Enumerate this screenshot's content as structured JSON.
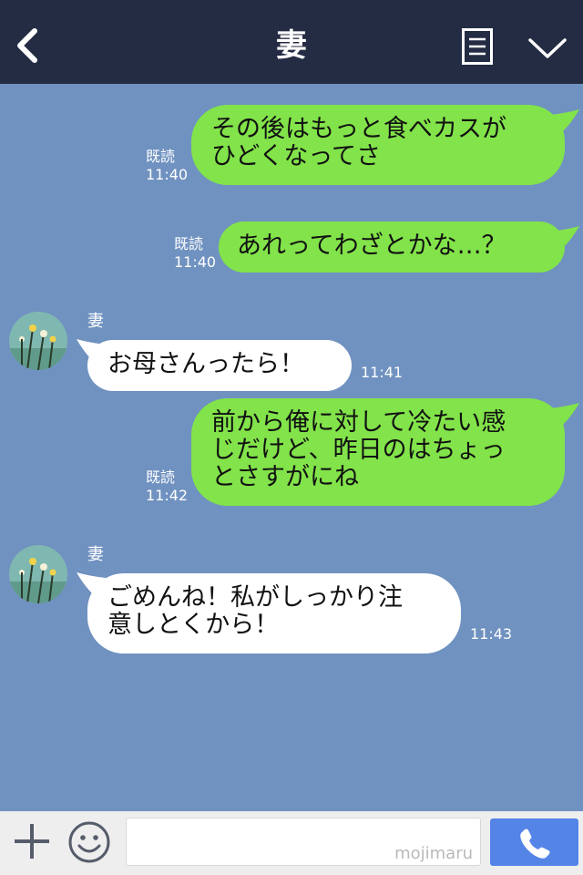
{
  "header": {
    "title": "妻",
    "colors": {
      "bar": "#242c44",
      "chat_bg": "#7092c0",
      "outgoing": "#82e34a",
      "incoming": "#ffffff",
      "call": "#5384e6"
    }
  },
  "messages": [
    {
      "direction": "outgoing",
      "lines": [
        "その後はもっと食べカスが",
        "ひどくなってさ"
      ],
      "read": "既読",
      "time": "11:40"
    },
    {
      "direction": "outgoing",
      "lines": [
        "あれってわざとかな…？"
      ],
      "read": "既読",
      "time": "11:40"
    },
    {
      "direction": "incoming",
      "sender": "妻",
      "lines": [
        "お母さんったら！"
      ],
      "time": "11:41"
    },
    {
      "direction": "outgoing",
      "lines": [
        "前から俺に対して冷たい感",
        "じだけど、昨日のはちょっ",
        "とさすがにね"
      ],
      "read": "既読",
      "time": "11:42"
    },
    {
      "direction": "incoming",
      "sender": "妻",
      "lines": [
        "ごめんね！私がしっかり注",
        "意しとくから！"
      ],
      "time": "11:43"
    }
  ],
  "footer": {
    "watermark": "mojimaru",
    "icons": [
      "plus-icon",
      "smiley-icon",
      "phone-icon"
    ]
  }
}
